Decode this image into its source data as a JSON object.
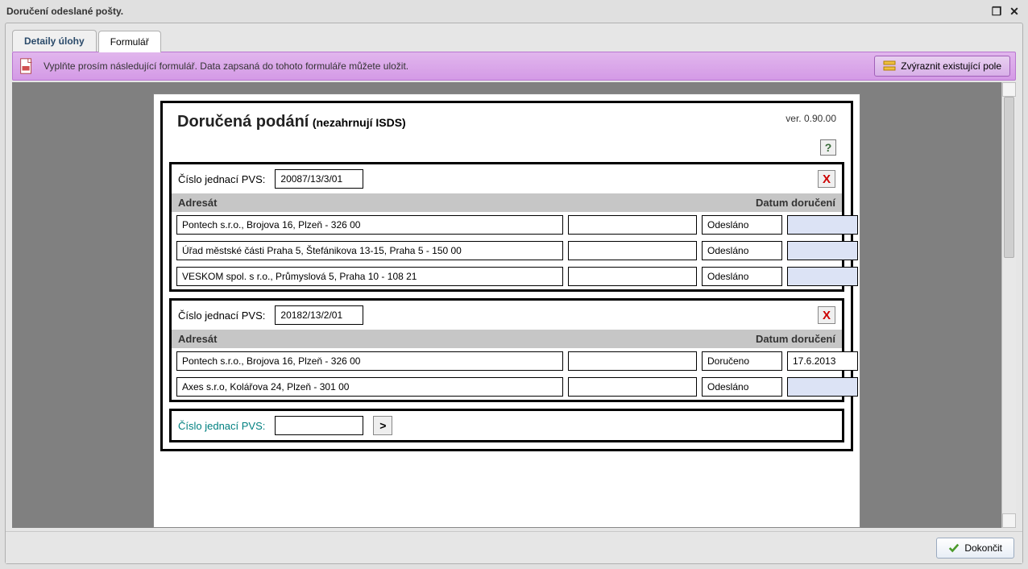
{
  "window": {
    "title": "Doručení odeslané pošty."
  },
  "tabs": {
    "details": "Detaily úlohy",
    "form": "Formulář"
  },
  "banner": {
    "message": "Vyplňte prosím následující formulář. Data zapsaná do tohoto formuláře můžete uložit.",
    "highlight_btn": "Zvýraznit existující pole"
  },
  "form": {
    "title": "Doručená podání",
    "subtitle": "(nezahrnují ISDS)",
    "version": "ver. 0.90.00",
    "help": "?",
    "label_cj": "Číslo jednací PVS:",
    "col_adresat": "Adresát",
    "col_datum": "Datum doručení",
    "close_x": "X",
    "arrow": ">",
    "sections": [
      {
        "cj": "20087/13/3/01",
        "rows": [
          {
            "adresat": "Pontech s.r.o., Brojova 16, Plzeň - 326 00",
            "f2": "",
            "status": "Odesláno",
            "date": ""
          },
          {
            "adresat": "Úřad městské části Praha 5, Štefánikova 13-15, Praha 5 - 150 00",
            "f2": "",
            "status": "Odesláno",
            "date": ""
          },
          {
            "adresat": "VESKOM spol. s r.o., Průmyslová 5, Praha 10 - 108 21",
            "f2": "",
            "status": "Odesláno",
            "date": ""
          }
        ]
      },
      {
        "cj": "20182/13/2/01",
        "rows": [
          {
            "adresat": "Pontech s.r.o., Brojova 16, Plzeň - 326 00",
            "f2": "",
            "status": "Doručeno",
            "date": "17.6.2013"
          },
          {
            "adresat": "Axes s.r.o, Kolářova 24, Plzeň - 301 00",
            "f2": "",
            "status": "Odesláno",
            "date": ""
          }
        ]
      }
    ],
    "new_cj": ""
  },
  "footer": {
    "done": "Dokončit"
  }
}
